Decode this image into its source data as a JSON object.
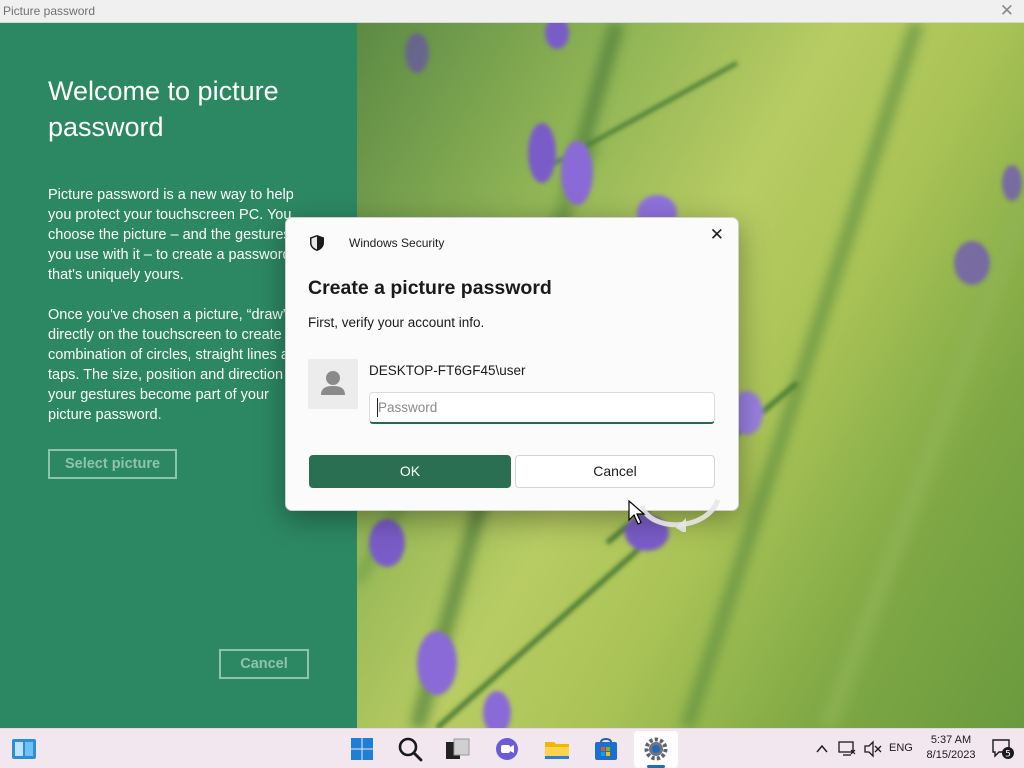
{
  "window": {
    "title": "Picture password"
  },
  "left_panel": {
    "heading": "Welcome to picture password",
    "paragraph1": "Picture password is a new way to help\nyou protect your touchscreen PC. You\nchoose the picture – and the gestures\nyou use with it – to create a password\nthat's uniquely yours.",
    "paragraph2": "Once you've chosen a picture, “draw”\ndirectly on the touchscreen to create a\ncombination of circles, straight lines and\ntaps. The size, position and direction of\nyour gestures become part of your\npicture password.",
    "select_button": "Select picture",
    "cancel_button": "Cancel"
  },
  "dialog": {
    "caption": "Windows Security",
    "title": "Create a picture password",
    "subtitle": "First, verify your account info.",
    "account": "DESKTOP-FT6GF45\\user",
    "password_placeholder": "Password",
    "password_value": "",
    "ok_label": "OK",
    "cancel_label": "Cancel"
  },
  "taskbar": {
    "icons": [
      "widgets-icon",
      "start-icon",
      "search-icon",
      "task-view-icon",
      "chat-icon",
      "file-explorer-icon",
      "store-icon",
      "settings-icon"
    ],
    "active_app": "settings-icon",
    "tray": {
      "language": "ENG",
      "time": "5:37 AM",
      "date": "8/15/2023",
      "notification_count": "5"
    }
  },
  "colors": {
    "panel_green": "#2c8863",
    "button_green": "#2b6f52",
    "taskbar": "#f3e7ef"
  }
}
